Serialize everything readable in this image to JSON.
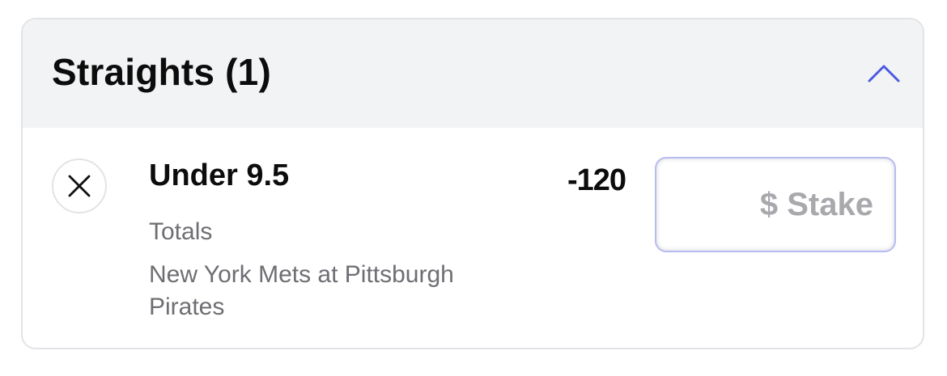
{
  "section": {
    "title": "Straights (1)",
    "collapse_icon": "chevron-up-icon",
    "accent_color": "#4a5ae0"
  },
  "bet": {
    "remove_icon": "close-icon",
    "selection": "Under 9.5",
    "market": "Totals",
    "event": "New York Mets at Pittsburgh Pirates",
    "odds": "-120",
    "stake": {
      "value": "",
      "placeholder": "$ Stake"
    }
  }
}
